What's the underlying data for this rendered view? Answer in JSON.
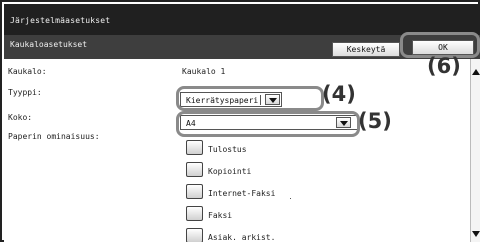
{
  "window": {
    "title": "Järjestelmäasetukset"
  },
  "subheader": {
    "title": "Kaukaloasetukset",
    "cancel_label": "Keskeytä",
    "ok_label": "OK"
  },
  "fields": {
    "tray": {
      "label": "Kaukalo:",
      "value": "Kaukalo 1"
    },
    "type": {
      "label": "Tyyppi:",
      "value": "Kierrätyspaperi"
    },
    "size": {
      "label": "Koko:",
      "value": "A4"
    },
    "properties": {
      "label": "Paperin ominaisuus:"
    }
  },
  "properties": [
    {
      "label": "Tulostus"
    },
    {
      "label": "Kopiointi"
    },
    {
      "label": "Internet-Faksi"
    },
    {
      "label": "Faksi"
    },
    {
      "label": "Asiak. arkist."
    }
  ],
  "callouts": {
    "type": "(4)",
    "size": "(5)",
    "ok": "(6)"
  }
}
